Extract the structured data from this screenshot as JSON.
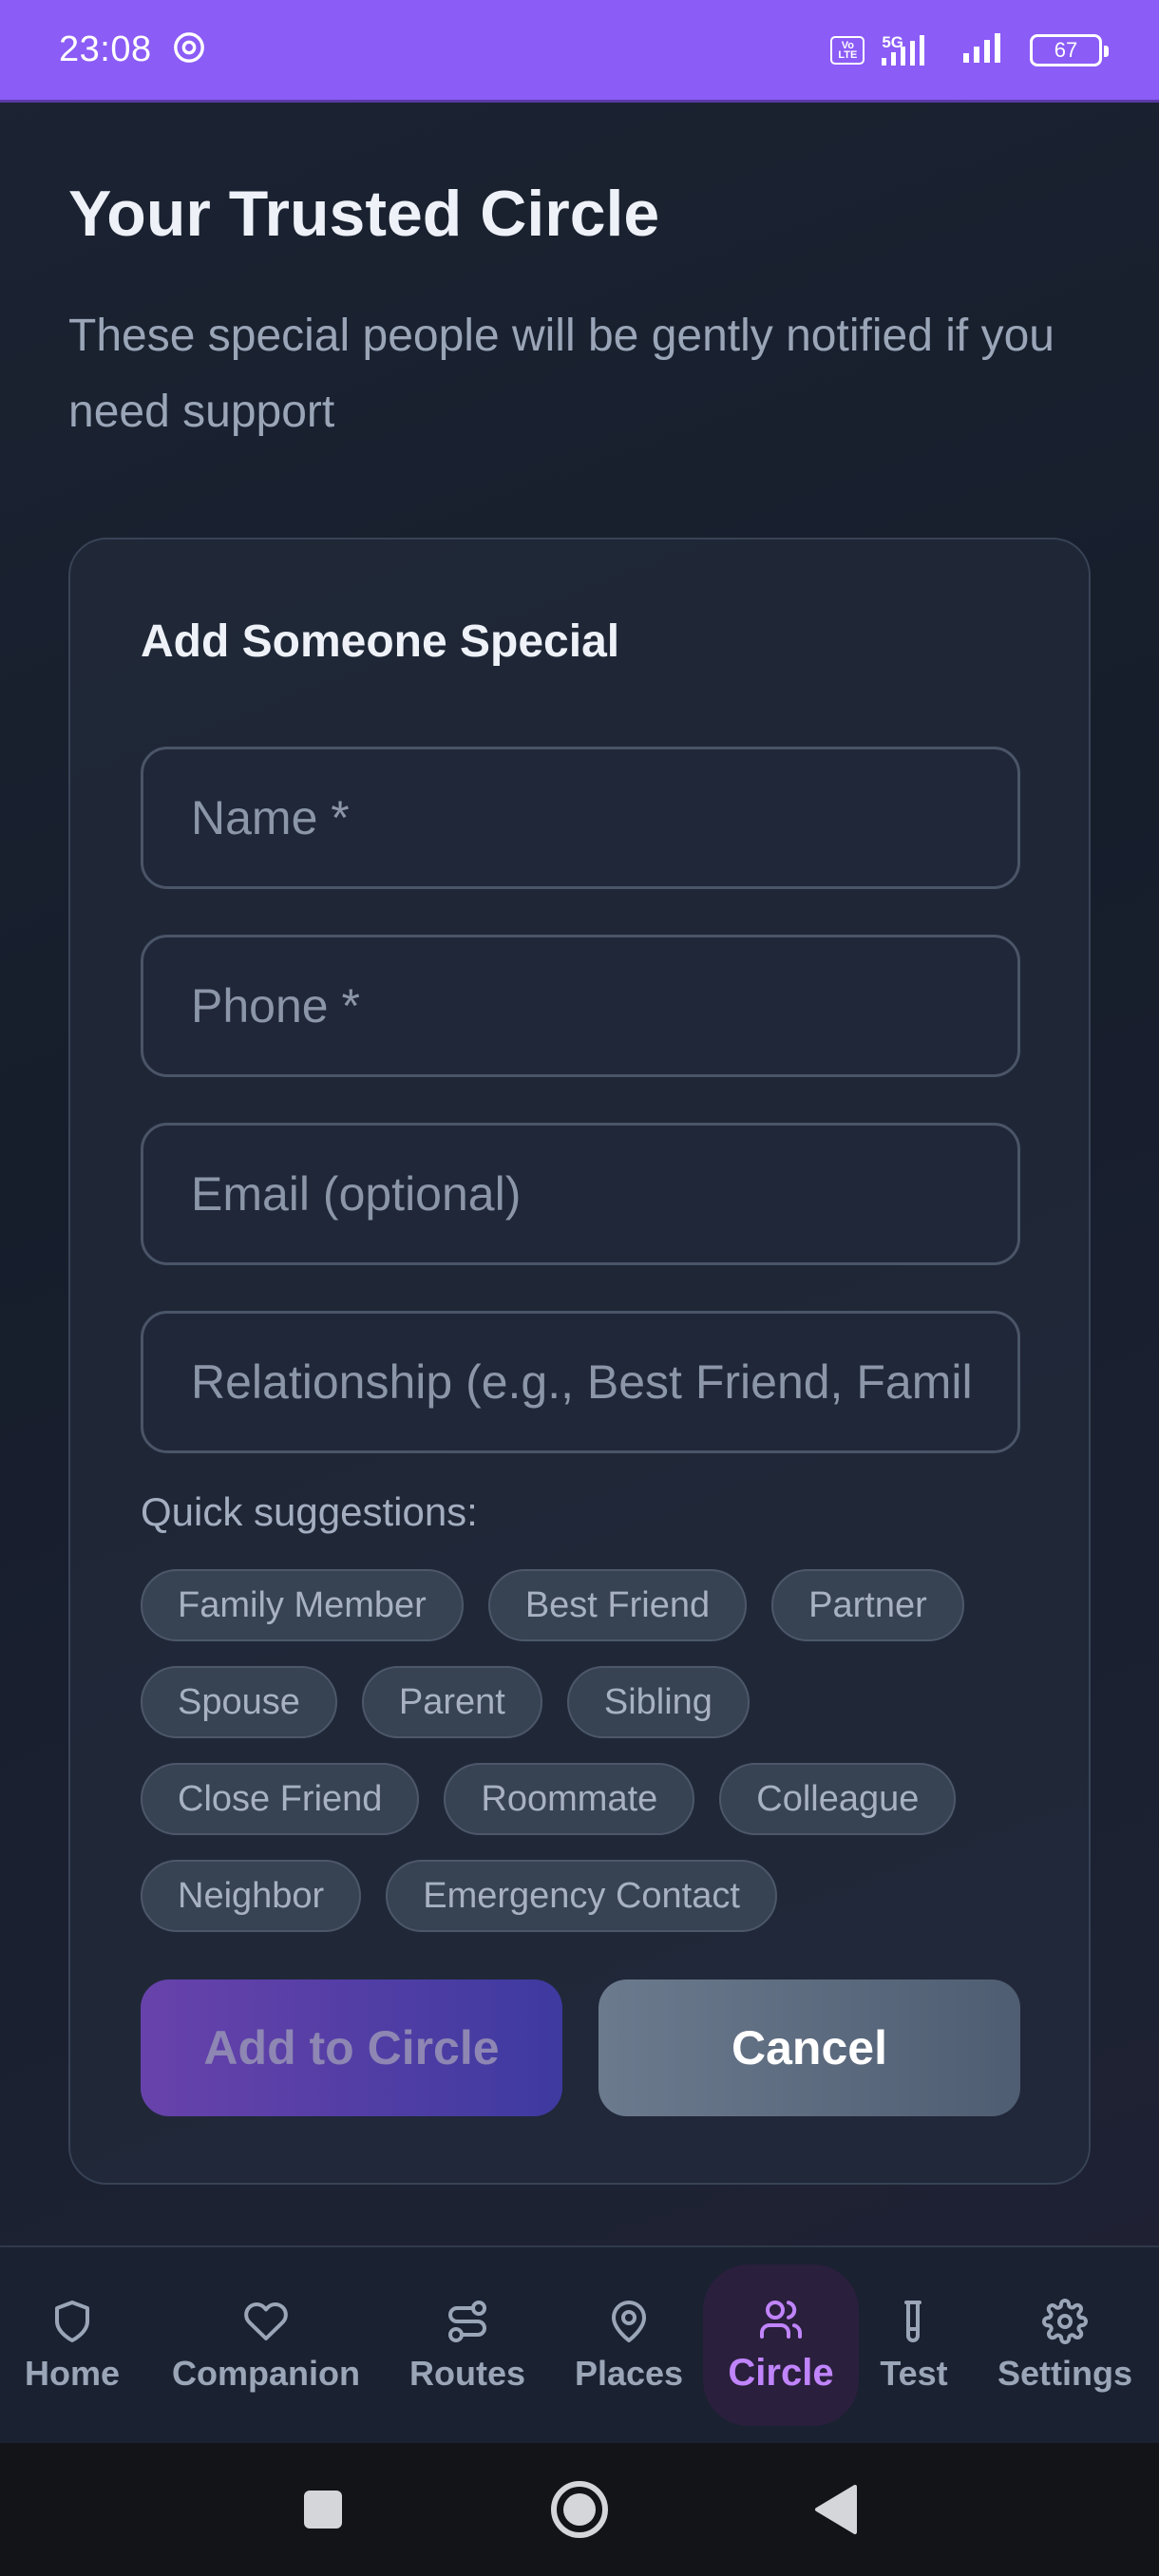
{
  "status_bar": {
    "time": "23:08",
    "network": "5G",
    "volte": "Vo LTE",
    "battery": "67"
  },
  "header": {
    "title": "Your Trusted Circle",
    "subtitle": "These special people will be gently notified if you need support"
  },
  "form": {
    "title": "Add Someone Special",
    "name_placeholder": "Name *",
    "phone_placeholder": "Phone *",
    "email_placeholder": "Email (optional)",
    "relationship_placeholder": "Relationship (e.g., Best Friend, Family Member)",
    "suggestions_label": "Quick suggestions:",
    "suggestions": [
      "Family Member",
      "Best Friend",
      "Partner",
      "Spouse",
      "Parent",
      "Sibling",
      "Close Friend",
      "Roommate",
      "Colleague",
      "Neighbor",
      "Emergency Contact"
    ],
    "add_button": "Add to Circle",
    "cancel_button": "Cancel"
  },
  "bottom_nav": {
    "items": [
      {
        "label": "Home",
        "icon": "shield-icon"
      },
      {
        "label": "Companion",
        "icon": "heart-icon"
      },
      {
        "label": "Routes",
        "icon": "route-icon"
      },
      {
        "label": "Places",
        "icon": "map-pin-icon"
      },
      {
        "label": "Circle",
        "icon": "users-icon",
        "active": true
      },
      {
        "label": "Test",
        "icon": "test-tube-icon"
      },
      {
        "label": "Settings",
        "icon": "gear-icon"
      }
    ]
  },
  "colors": {
    "accent": "#8b5cf6",
    "active_nav": "#c084fc",
    "background": "#1a2131"
  }
}
